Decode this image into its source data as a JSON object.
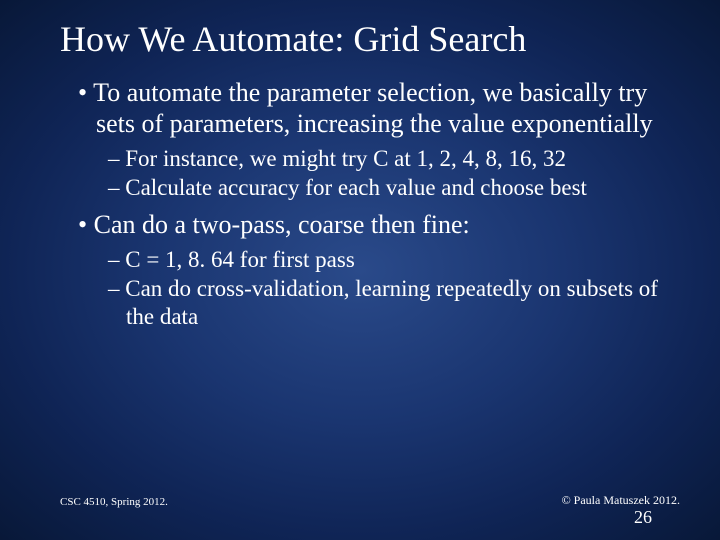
{
  "title": "How We Automate:  Grid Search",
  "bullets": {
    "b1": "To automate the parameter selection, we basically try sets of parameters, increasing the value exponentially",
    "b1a": "For instance, we might try C at 1, 2, 4, 8, 16, 32",
    "b1b": "Calculate accuracy for each value and choose best",
    "b2": "Can do a two-pass, coarse then fine:",
    "b2a": "C = 1, 8. 64 for first pass",
    "b2b": "Can do cross-validation, learning repeatedly on subsets of the data"
  },
  "footer": {
    "left": "CSC 4510, Spring 2012.",
    "right": "© Paula Matuszek 2012."
  },
  "page": "26"
}
